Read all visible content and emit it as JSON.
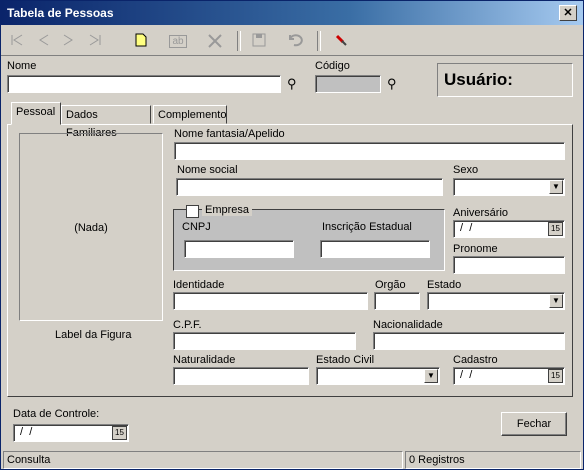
{
  "window": {
    "title": "Tabela de Pessoas",
    "close_glyph": "✕"
  },
  "toolbar": {
    "icons": [
      "first-record-icon",
      "prev-record-icon",
      "next-record-icon",
      "last-record-icon",
      "new-record-icon",
      "edit-record-icon",
      "delete-record-icon",
      "save-icon",
      "undo-icon",
      "clear-filter-icon"
    ],
    "edit_text": "ab"
  },
  "header": {
    "nome_label": "Nome",
    "nome_value": "",
    "codigo_label": "Código",
    "codigo_value": "",
    "usuario_label": "Usuário:"
  },
  "tabs": [
    "Pessoal",
    "Dados Familiares",
    "Complemento"
  ],
  "pessoal": {
    "figura_placeholder": "(Nada)",
    "figura_label": "Label da Figura",
    "nome_fantasia_label": "Nome fantasia/Apelido",
    "nome_fantasia_value": "",
    "nome_social_label": "Nome social",
    "nome_social_value": "",
    "sexo_label": "Sexo",
    "sexo_value": "",
    "empresa_label": "Empresa",
    "empresa_checked": false,
    "cnpj_label": "CNPJ",
    "cnpj_value": "",
    "inscricao_label": "Inscrição Estadual",
    "inscricao_value": "",
    "aniversario_label": "Aniversário",
    "aniversario_value": " /  /",
    "pronome_label": "Pronome",
    "pronome_value": "",
    "identidade_label": "Identidade",
    "identidade_value": "",
    "orgao_label": "Orgão",
    "orgao_value": "",
    "estado_label": "Estado",
    "estado_value": "",
    "cpf_label": "C.P.F.",
    "cpf_value": "",
    "nacionalidade_label": "Nacionalidade",
    "nacionalidade_value": "",
    "naturalidade_label": "Naturalidade",
    "naturalidade_value": "",
    "estado_civil_label": "Estado Civil",
    "estado_civil_value": "",
    "cadastro_label": "Cadastro",
    "cadastro_value": " /  /"
  },
  "footer": {
    "data_controle_label": "Data de Controle:",
    "data_controle_value": " /  /",
    "fechar_label": "Fechar",
    "status_mode": "Consulta",
    "status_count": "0 Registros",
    "calendar_glyph": "15"
  }
}
